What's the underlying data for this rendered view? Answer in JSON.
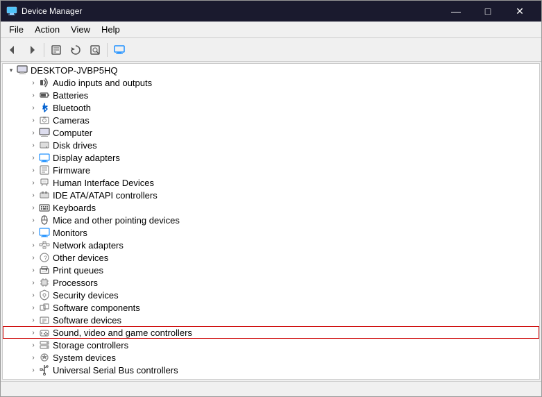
{
  "window": {
    "title": "Device Manager",
    "title_icon": "⚙"
  },
  "title_bar_controls": {
    "minimize": "—",
    "maximize": "□",
    "close": "✕"
  },
  "menu": {
    "items": [
      "File",
      "Action",
      "View",
      "Help"
    ]
  },
  "toolbar": {
    "buttons": [
      "←",
      "→",
      "⊞",
      "✎",
      "⊡",
      "🖥"
    ]
  },
  "tree": {
    "root": {
      "arrow": "▾",
      "label": "DESKTOP-JVBP5HQ"
    },
    "items": [
      {
        "label": "Audio inputs and outputs",
        "icon": "🔊",
        "indent": 2,
        "arrow": "›"
      },
      {
        "label": "Batteries",
        "icon": "🔋",
        "indent": 2,
        "arrow": "›"
      },
      {
        "label": "Bluetooth",
        "icon": "⬡",
        "indent": 2,
        "arrow": "›"
      },
      {
        "label": "Cameras",
        "icon": "📷",
        "indent": 2,
        "arrow": "›"
      },
      {
        "label": "Computer",
        "icon": "🖥",
        "indent": 2,
        "arrow": "›"
      },
      {
        "label": "Disk drives",
        "icon": "💾",
        "indent": 2,
        "arrow": "›"
      },
      {
        "label": "Display adapters",
        "icon": "🖥",
        "indent": 2,
        "arrow": "›"
      },
      {
        "label": "Firmware",
        "icon": "📋",
        "indent": 2,
        "arrow": "›"
      },
      {
        "label": "Human Interface Devices",
        "icon": "🎮",
        "indent": 2,
        "arrow": "›"
      },
      {
        "label": "IDE ATA/ATAPI controllers",
        "icon": "💾",
        "indent": 2,
        "arrow": "›"
      },
      {
        "label": "Keyboards",
        "icon": "⌨",
        "indent": 2,
        "arrow": "›"
      },
      {
        "label": "Mice and other pointing devices",
        "icon": "🖱",
        "indent": 2,
        "arrow": "›"
      },
      {
        "label": "Monitors",
        "icon": "🖥",
        "indent": 2,
        "arrow": "›"
      },
      {
        "label": "Network adapters",
        "icon": "🌐",
        "indent": 2,
        "arrow": "›"
      },
      {
        "label": "Other devices",
        "icon": "❓",
        "indent": 2,
        "arrow": "›"
      },
      {
        "label": "Print queues",
        "icon": "🖨",
        "indent": 2,
        "arrow": "›"
      },
      {
        "label": "Processors",
        "icon": "⚙",
        "indent": 2,
        "arrow": "›"
      },
      {
        "label": "Security devices",
        "icon": "🔒",
        "indent": 2,
        "arrow": "›"
      },
      {
        "label": "Software components",
        "icon": "📦",
        "indent": 2,
        "arrow": "›"
      },
      {
        "label": "Software devices",
        "icon": "📦",
        "indent": 2,
        "arrow": "›"
      },
      {
        "label": "Sound, video and game controllers",
        "icon": "🎵",
        "indent": 2,
        "arrow": "›",
        "highlighted": true
      },
      {
        "label": "Storage controllers",
        "icon": "💾",
        "indent": 2,
        "arrow": "›"
      },
      {
        "label": "System devices",
        "icon": "⚙",
        "indent": 2,
        "arrow": "›"
      },
      {
        "label": "Universal Serial Bus controllers",
        "icon": "🔌",
        "indent": 2,
        "arrow": "›"
      }
    ]
  }
}
